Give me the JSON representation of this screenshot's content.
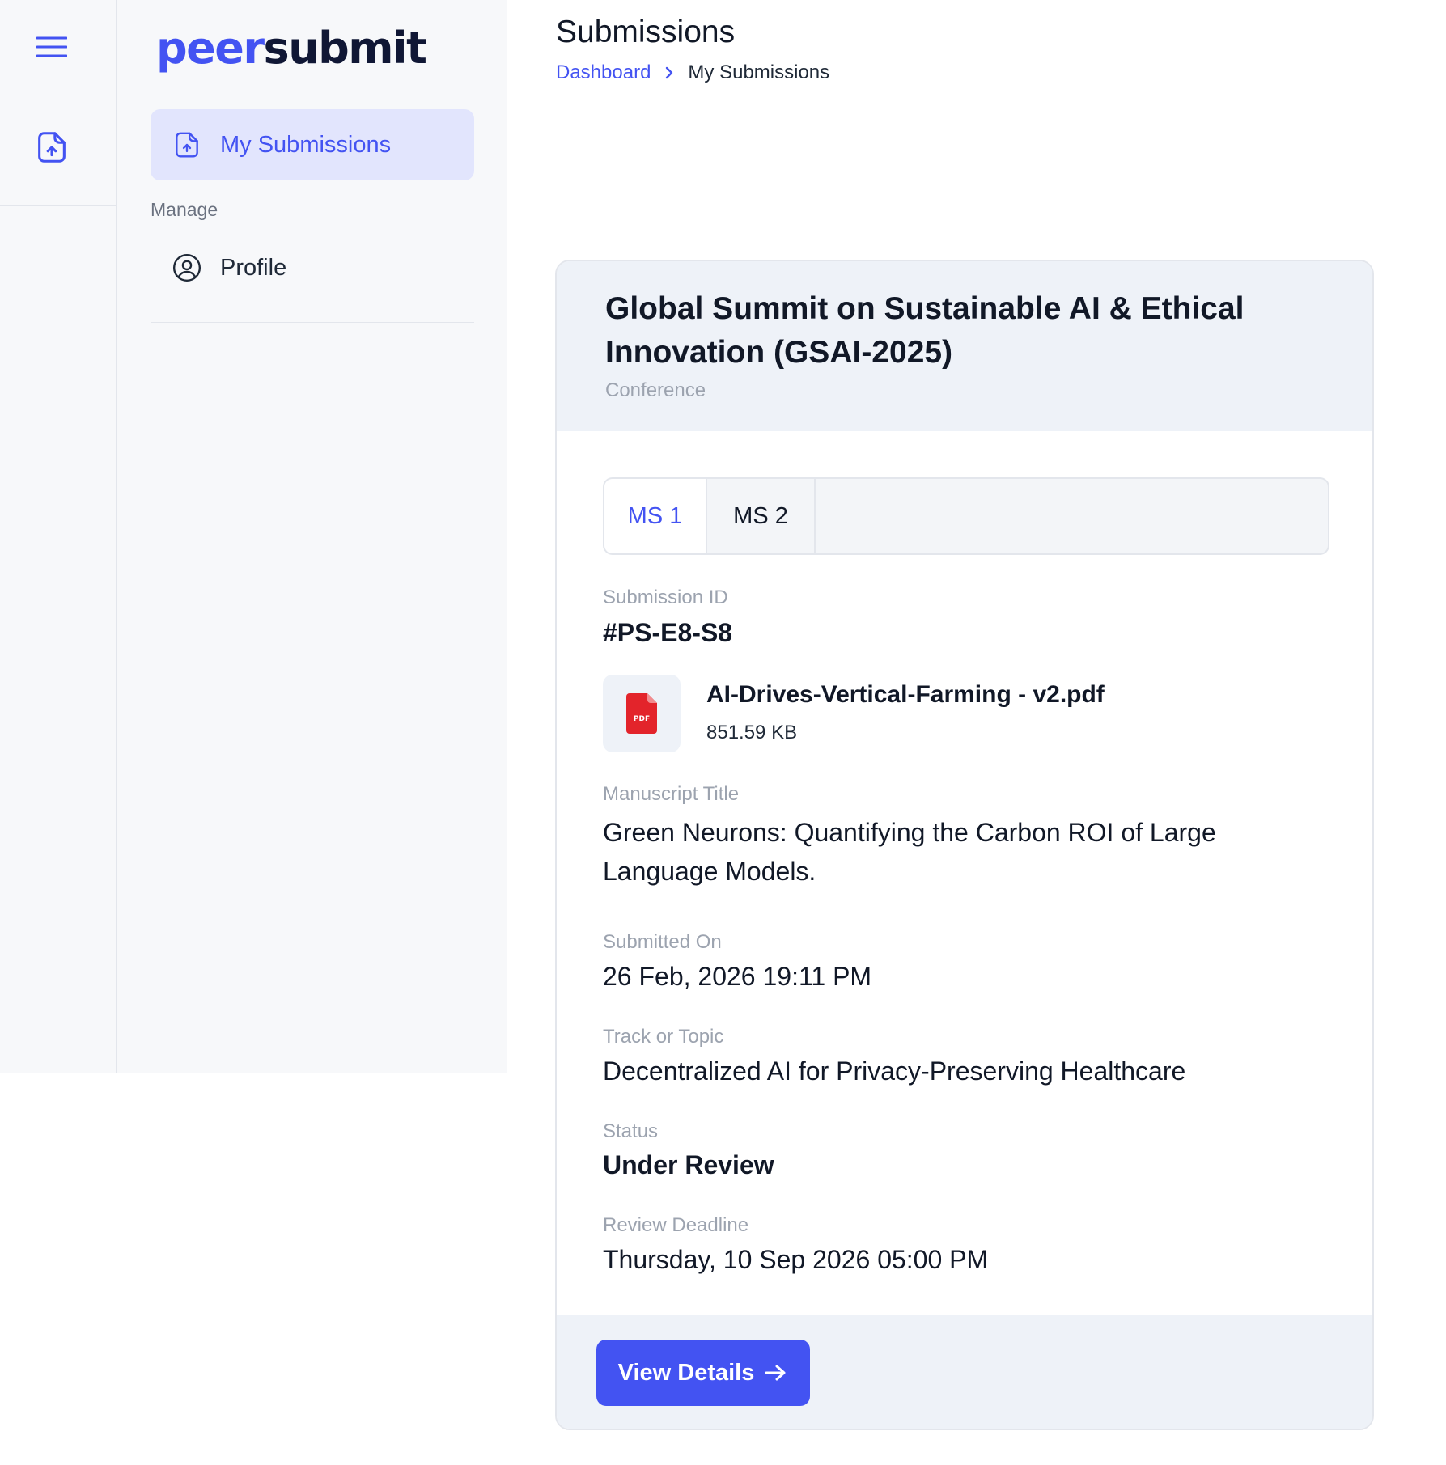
{
  "app": {
    "logo_part1": "peer",
    "logo_part2": "submit",
    "brand_color": "#4353f2"
  },
  "rail": {
    "menu_icon": "hamburger-menu-icon",
    "submit_icon": "file-upload-icon"
  },
  "sidebar": {
    "active_item": {
      "label": "My Submissions",
      "icon": "file-upload-icon"
    },
    "section_label": "Manage",
    "items": [
      {
        "label": "Profile",
        "icon": "user-circle-icon"
      }
    ]
  },
  "header": {
    "title": "Submissions",
    "breadcrumb": [
      {
        "label": "Dashboard"
      },
      {
        "label": "My Submissions"
      }
    ]
  },
  "card": {
    "title": "Global Summit on Sustainable AI & Ethical Innovation (GSAI-2025)",
    "type": "Conference",
    "tabs": [
      {
        "label": "MS 1",
        "active": true
      },
      {
        "label": "MS 2",
        "active": false
      }
    ],
    "submission_id_label": "Submission ID",
    "submission_id": "#PS-E8-S8",
    "file": {
      "name": "AI-Drives-Vertical-Farming - v2.pdf",
      "size": "851.59 KB",
      "icon": "pdf-file-icon",
      "icon_text": "PDF"
    },
    "manuscript_title_label": "Manuscript Title",
    "manuscript_title": "Green Neurons: Quantifying the Carbon ROI of Large Language Models.",
    "submitted_on_label": "Submitted On",
    "submitted_on": "26 Feb, 2026 19:11 PM",
    "track_label": "Track or Topic",
    "track": "Decentralized AI for Privacy-Preserving Healthcare",
    "status_label": "Status",
    "status": "Under Review",
    "deadline_label": "Review Deadline",
    "deadline": "Thursday, 10 Sep 2026 05:00 PM",
    "button_label": "View Details"
  }
}
